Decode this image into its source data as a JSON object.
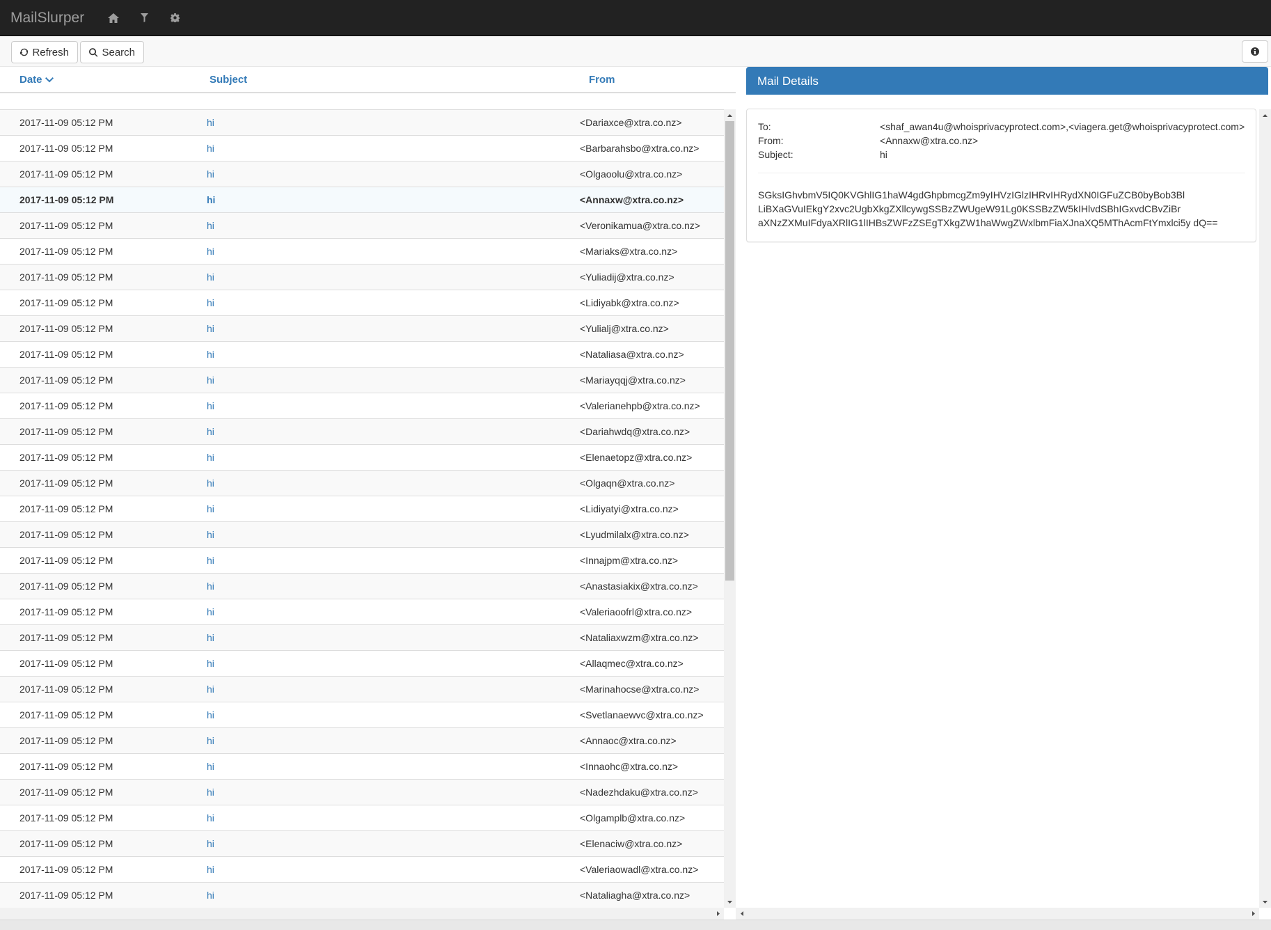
{
  "navbar": {
    "brand": "MailSlurper",
    "icons": [
      "home-icon",
      "filter-icon",
      "gear-icon"
    ]
  },
  "toolbar": {
    "refresh_label": "Refresh",
    "search_label": "Search"
  },
  "list": {
    "columns": {
      "date": "Date",
      "subject": "Subject",
      "from": "From"
    },
    "rows": [
      {
        "date": "2017-11-09 05:12 PM",
        "subject": "hi",
        "from": "<Dariaxce@xtra.co.nz>"
      },
      {
        "date": "2017-11-09 05:12 PM",
        "subject": "hi",
        "from": "<Barbarahsbo@xtra.co.nz>"
      },
      {
        "date": "2017-11-09 05:12 PM",
        "subject": "hi",
        "from": "<Olgaoolu@xtra.co.nz>"
      },
      {
        "date": "2017-11-09 05:12 PM",
        "subject": "hi",
        "from": "<Annaxw@xtra.co.nz>",
        "active": true
      },
      {
        "date": "2017-11-09 05:12 PM",
        "subject": "hi",
        "from": "<Veronikamua@xtra.co.nz>"
      },
      {
        "date": "2017-11-09 05:12 PM",
        "subject": "hi",
        "from": "<Mariaks@xtra.co.nz>"
      },
      {
        "date": "2017-11-09 05:12 PM",
        "subject": "hi",
        "from": "<Yuliadij@xtra.co.nz>"
      },
      {
        "date": "2017-11-09 05:12 PM",
        "subject": "hi",
        "from": "<Lidiyabk@xtra.co.nz>"
      },
      {
        "date": "2017-11-09 05:12 PM",
        "subject": "hi",
        "from": "<Yulialj@xtra.co.nz>"
      },
      {
        "date": "2017-11-09 05:12 PM",
        "subject": "hi",
        "from": "<Nataliasa@xtra.co.nz>"
      },
      {
        "date": "2017-11-09 05:12 PM",
        "subject": "hi",
        "from": "<Mariayqqj@xtra.co.nz>"
      },
      {
        "date": "2017-11-09 05:12 PM",
        "subject": "hi",
        "from": "<Valerianehpb@xtra.co.nz>"
      },
      {
        "date": "2017-11-09 05:12 PM",
        "subject": "hi",
        "from": "<Dariahwdq@xtra.co.nz>"
      },
      {
        "date": "2017-11-09 05:12 PM",
        "subject": "hi",
        "from": "<Elenaetopz@xtra.co.nz>"
      },
      {
        "date": "2017-11-09 05:12 PM",
        "subject": "hi",
        "from": "<Olgaqn@xtra.co.nz>"
      },
      {
        "date": "2017-11-09 05:12 PM",
        "subject": "hi",
        "from": "<Lidiyatyi@xtra.co.nz>"
      },
      {
        "date": "2017-11-09 05:12 PM",
        "subject": "hi",
        "from": "<Lyudmilalx@xtra.co.nz>"
      },
      {
        "date": "2017-11-09 05:12 PM",
        "subject": "hi",
        "from": "<Innajpm@xtra.co.nz>"
      },
      {
        "date": "2017-11-09 05:12 PM",
        "subject": "hi",
        "from": "<Anastasiakix@xtra.co.nz>"
      },
      {
        "date": "2017-11-09 05:12 PM",
        "subject": "hi",
        "from": "<Valeriaoofrl@xtra.co.nz>"
      },
      {
        "date": "2017-11-09 05:12 PM",
        "subject": "hi",
        "from": "<Nataliaxwzm@xtra.co.nz>"
      },
      {
        "date": "2017-11-09 05:12 PM",
        "subject": "hi",
        "from": "<Allaqmec@xtra.co.nz>"
      },
      {
        "date": "2017-11-09 05:12 PM",
        "subject": "hi",
        "from": "<Marinahocse@xtra.co.nz>"
      },
      {
        "date": "2017-11-09 05:12 PM",
        "subject": "hi",
        "from": "<Svetlanaewvc@xtra.co.nz>"
      },
      {
        "date": "2017-11-09 05:12 PM",
        "subject": "hi",
        "from": "<Annaoc@xtra.co.nz>"
      },
      {
        "date": "2017-11-09 05:12 PM",
        "subject": "hi",
        "from": "<Innaohc@xtra.co.nz>"
      },
      {
        "date": "2017-11-09 05:12 PM",
        "subject": "hi",
        "from": "<Nadezhdaku@xtra.co.nz>"
      },
      {
        "date": "2017-11-09 05:12 PM",
        "subject": "hi",
        "from": "<Olgamplb@xtra.co.nz>"
      },
      {
        "date": "2017-11-09 05:12 PM",
        "subject": "hi",
        "from": "<Elenaciw@xtra.co.nz>"
      },
      {
        "date": "2017-11-09 05:12 PM",
        "subject": "hi",
        "from": "<Valeriaowadl@xtra.co.nz>"
      },
      {
        "date": "2017-11-09 05:12 PM",
        "subject": "hi",
        "from": "<Nataliagha@xtra.co.nz>"
      }
    ]
  },
  "details": {
    "heading": "Mail Details",
    "to_label": "To:",
    "to_value": "<shaf_awan4u@whoisprivacyprotect.com>,<viagera.get@whoisprivacyprotect.com>",
    "from_label": "From:",
    "from_value": "<Annaxw@xtra.co.nz>",
    "subject_label": "Subject:",
    "subject_value": "hi",
    "body_lines": [
      "SGksIGhvbmV5IQ0KVGhlIG1haW4gdGhpbmcgZm9yIHVzIGlzIHRvIHRydXN0IGFuZCB0byBob3Bl",
      "LiBXaGVuIEkgY2xvc2UgbXkgZXllcywgSSBzZWUgeW91Lg0KSSBzZW5kIHlvdSBhIGxvdCBvZiBr",
      "aXNzZXMuIFdyaXRlIG1lIHBsZWFzZSEgTXkgZW1haWwgZWxlbmFiaXJnaXQ5MThAcmFtYmxlci5y dQ=="
    ]
  },
  "colors": {
    "navbar": "#222222",
    "link": "#337ab7",
    "panel_heading": "#337ab7"
  }
}
